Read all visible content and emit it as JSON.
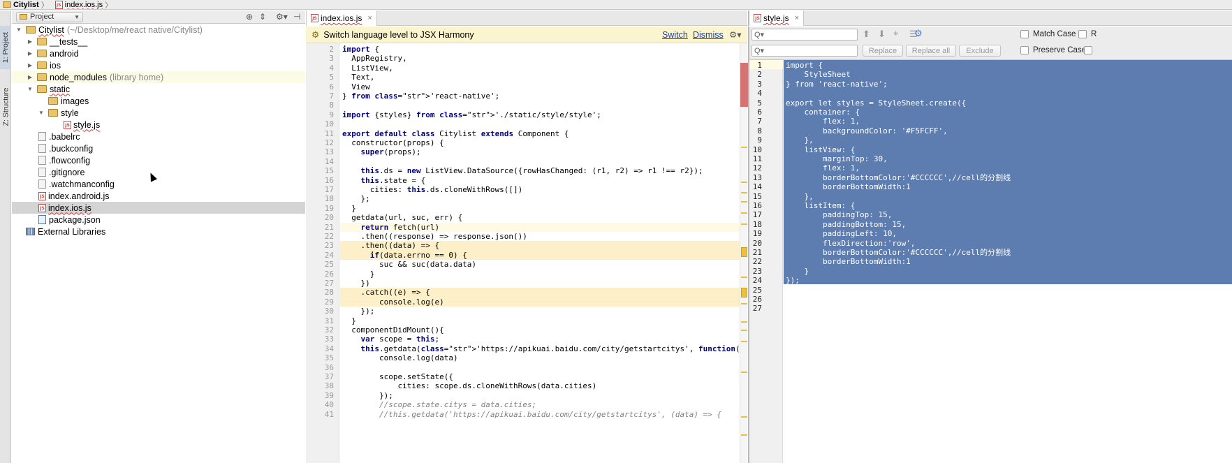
{
  "breadcrumb": {
    "items": [
      "Citylist",
      "index.ios.js"
    ]
  },
  "toolstrip": {
    "project_label": "1: Project",
    "structure_label": "Z: Structure"
  },
  "project_panel": {
    "combo_label": "Project",
    "tree": [
      {
        "name": "Citylist",
        "hint": "(~/Desktop/me/react native/Citylist)",
        "kind": "root"
      },
      {
        "name": "__tests__",
        "hint": "",
        "kind": "folder"
      },
      {
        "name": "android",
        "hint": "",
        "kind": "folder"
      },
      {
        "name": "ios",
        "hint": "",
        "kind": "folder"
      },
      {
        "name": "node_modules",
        "hint": "(library home)",
        "kind": "folder"
      },
      {
        "name": "static",
        "hint": "",
        "kind": "folder"
      },
      {
        "name": "images",
        "hint": "",
        "kind": "folder"
      },
      {
        "name": "style",
        "hint": "",
        "kind": "folder"
      },
      {
        "name": "style.js",
        "hint": "",
        "kind": "js"
      },
      {
        "name": ".babelrc",
        "hint": "",
        "kind": "file"
      },
      {
        "name": ".buckconfig",
        "hint": "",
        "kind": "file"
      },
      {
        "name": ".flowconfig",
        "hint": "",
        "kind": "file"
      },
      {
        "name": ".gitignore",
        "hint": "",
        "kind": "file"
      },
      {
        "name": ".watchmanconfig",
        "hint": "",
        "kind": "file"
      },
      {
        "name": "index.android.js",
        "hint": "",
        "kind": "js"
      },
      {
        "name": "index.ios.js",
        "hint": "",
        "kind": "js"
      },
      {
        "name": "package.json",
        "hint": "",
        "kind": "json"
      },
      {
        "name": "External Libraries",
        "hint": "",
        "kind": "lib"
      }
    ]
  },
  "center_editor": {
    "tab_label": "index.ios.js",
    "tab_close": "×",
    "banner": {
      "text": "Switch language level to JSX Harmony",
      "switch_label": "Switch",
      "dismiss_label": "Dismiss"
    },
    "lines": [
      {
        "n": "2",
        "t": "import {"
      },
      {
        "n": "3",
        "t": "  AppRegistry,"
      },
      {
        "n": "4",
        "t": "  ListView,"
      },
      {
        "n": "5",
        "t": "  Text,"
      },
      {
        "n": "6",
        "t": "  View"
      },
      {
        "n": "7",
        "t": "} from 'react-native';"
      },
      {
        "n": "8",
        "t": ""
      },
      {
        "n": "9",
        "t": "import {styles} from './static/style/style';"
      },
      {
        "n": "10",
        "t": ""
      },
      {
        "n": "11",
        "t": "export default class Citylist extends Component {"
      },
      {
        "n": "12",
        "t": "  constructor(props) {"
      },
      {
        "n": "13",
        "t": "    super(props);"
      },
      {
        "n": "14",
        "t": ""
      },
      {
        "n": "15",
        "t": "    this.ds = new ListView.DataSource({rowHasChanged: (r1, r2) => r1 !== r2});"
      },
      {
        "n": "16",
        "t": "    this.state = {"
      },
      {
        "n": "17",
        "t": "      cities: this.ds.cloneWithRows([])"
      },
      {
        "n": "18",
        "t": "    };"
      },
      {
        "n": "19",
        "t": "  }"
      },
      {
        "n": "20",
        "t": "  getdata(url, suc, err) {"
      },
      {
        "n": "21",
        "t": "    return fetch(url)"
      },
      {
        "n": "22",
        "t": "    .then((response) => response.json())"
      },
      {
        "n": "23",
        "t": "    .then((data) => {"
      },
      {
        "n": "24",
        "t": "      if(data.errno == 0) {"
      },
      {
        "n": "25",
        "t": "        suc && suc(data.data)"
      },
      {
        "n": "26",
        "t": "      }"
      },
      {
        "n": "27",
        "t": "    })"
      },
      {
        "n": "28",
        "t": "    .catch((e) => {"
      },
      {
        "n": "29",
        "t": "        console.log(e)"
      },
      {
        "n": "30",
        "t": "    });"
      },
      {
        "n": "31",
        "t": "  }"
      },
      {
        "n": "32",
        "t": "  componentDidMount(){"
      },
      {
        "n": "33",
        "t": "    var scope = this;"
      },
      {
        "n": "34",
        "t": "    this.getdata('https://apikuai.baidu.com/city/getstartcitys', function(data) {"
      },
      {
        "n": "35",
        "t": "        console.log(data)"
      },
      {
        "n": "36",
        "t": ""
      },
      {
        "n": "37",
        "t": "        scope.setState({"
      },
      {
        "n": "38",
        "t": "            cities: scope.ds.cloneWithRows(data.cities)"
      },
      {
        "n": "39",
        "t": "        });"
      },
      {
        "n": "40",
        "t": "        //scope.state.citys = data.cities;"
      },
      {
        "n": "41",
        "t": "        //this.getdata('https://apikuai.baidu.com/city/getstartcitys', (data) => {"
      }
    ]
  },
  "right_editor": {
    "tab_label": "style.js",
    "tab_close": "×",
    "find": {
      "search_placeholder": "Q▾",
      "replace_placeholder": "Q▾",
      "replace_label": "Replace",
      "replace_all_label": "Replace all",
      "exclude_label": "Exclude",
      "match_case_label": "Match Case",
      "preserve_case_label": "Preserve Case",
      "regex_label": "R"
    },
    "lines": [
      {
        "n": "1",
        "t": "import {"
      },
      {
        "n": "2",
        "t": "    StyleSheet"
      },
      {
        "n": "3",
        "t": "} from 'react-native';"
      },
      {
        "n": "4",
        "t": ""
      },
      {
        "n": "5",
        "t": "export let styles = StyleSheet.create({"
      },
      {
        "n": "6",
        "t": "    container: {"
      },
      {
        "n": "7",
        "t": "        flex: 1,"
      },
      {
        "n": "8",
        "t": "        backgroundColor: '#F5FCFF',"
      },
      {
        "n": "9",
        "t": "    },"
      },
      {
        "n": "10",
        "t": "    listView: {"
      },
      {
        "n": "11",
        "t": "        marginTop: 30,"
      },
      {
        "n": "12",
        "t": "        flex: 1,"
      },
      {
        "n": "13",
        "t": "        borderBottomColor:'#CCCCCC',//cell的分割线"
      },
      {
        "n": "14",
        "t": "        borderBottomWidth:1"
      },
      {
        "n": "15",
        "t": "    },"
      },
      {
        "n": "16",
        "t": "    listItem: {"
      },
      {
        "n": "17",
        "t": "        paddingTop: 15,"
      },
      {
        "n": "18",
        "t": "        paddingBottom: 15,"
      },
      {
        "n": "19",
        "t": "        paddingLeft: 10,"
      },
      {
        "n": "20",
        "t": "        flexDirection:'row',"
      },
      {
        "n": "21",
        "t": "        borderBottomColor:'#CCCCCC',//cell的分割线"
      },
      {
        "n": "22",
        "t": "        borderBottomWidth:1"
      },
      {
        "n": "23",
        "t": "    }"
      },
      {
        "n": "24",
        "t": "});"
      },
      {
        "n": "25",
        "t": ""
      },
      {
        "n": "26",
        "t": ""
      },
      {
        "n": "27",
        "t": ""
      }
    ]
  },
  "colors": {
    "selection": "#5d7cb0",
    "banner": "#fbf5cf",
    "keyword": "#000080",
    "string": "#008000",
    "warning_marker": "#e9c13b",
    "error_marker": "#d47373"
  }
}
